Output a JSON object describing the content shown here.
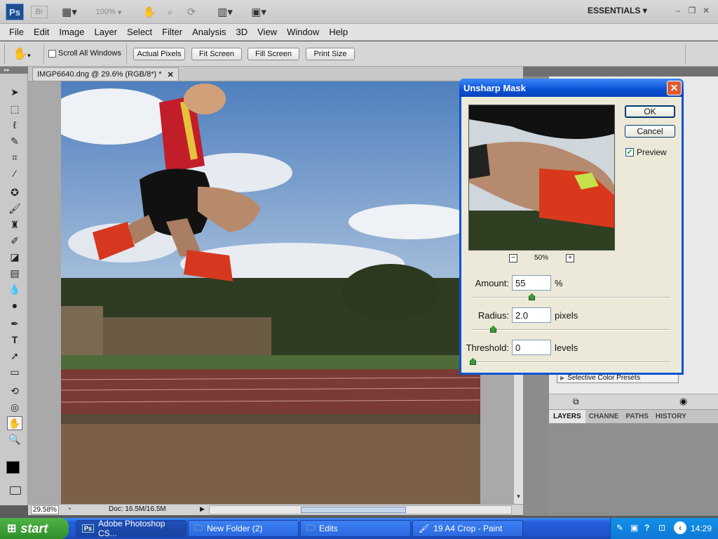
{
  "appbar": {
    "logo": "Ps",
    "bridge": "Br",
    "zoom": "100%",
    "workspace": "ESSENTIALS"
  },
  "menu": [
    "File",
    "Edit",
    "Image",
    "Layer",
    "Select",
    "Filter",
    "Analysis",
    "3D",
    "View",
    "Window",
    "Help"
  ],
  "options": {
    "scroll_all": "Scroll All Windows",
    "actual_pixels": "Actual Pixels",
    "fit_screen": "Fit Screen",
    "fill_screen": "Fill Screen",
    "print_size": "Print Size"
  },
  "document": {
    "tab_title": "IMGP6640.dng @ 29.6% (RGB/8*) *",
    "zoom_status": "29.58%",
    "doc_status": "Doc: 16.5M/16.5M"
  },
  "dialog": {
    "title": "Unsharp Mask",
    "ok": "OK",
    "cancel": "Cancel",
    "preview_label": "Preview",
    "preview_checked": true,
    "preview_zoom": "50%",
    "amount_label": "Amount:",
    "amount_value": "55",
    "amount_unit": "%",
    "radius_label": "Radius:",
    "radius_value": "2.0",
    "radius_unit": "pixels",
    "threshold_label": "Threshold:",
    "threshold_value": "0",
    "threshold_unit": "levels"
  },
  "panels": {
    "selective_color": "Selective Color Presets",
    "tabs": [
      "LAYERS",
      "CHANNE",
      "PATHS",
      "HISTORY"
    ]
  },
  "taskbar": {
    "start": "start",
    "tasks": [
      "Adobe Photoshop CS...",
      "New Folder (2)",
      "Edits",
      "19 A4 Crop - Paint"
    ],
    "clock": "14:29"
  },
  "colors": {
    "xp_blue": "#245edb",
    "start_green": "#3a9f34",
    "dialog_bg": "#ece9d8"
  }
}
